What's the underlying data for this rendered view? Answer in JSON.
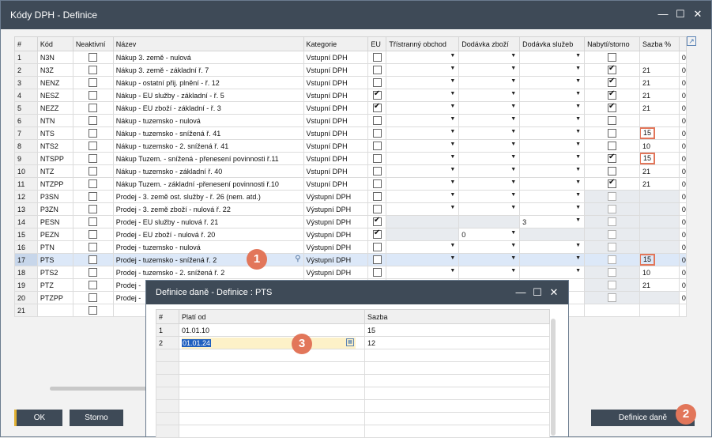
{
  "window": {
    "title": "Kódy DPH - Definice"
  },
  "grid": {
    "headers": [
      "#",
      "Kód",
      "Neaktivní",
      "Název",
      "Kategorie",
      "EU",
      "Třístranný obchod",
      "Dodávka zboží",
      "Dodávka služeb",
      "Nabytí/storno",
      "Sazba %"
    ],
    "rows": [
      {
        "n": "1",
        "kod": "N3N",
        "nazev": "Nákup 3. země - nulová",
        "kat": "Vstupní DPH",
        "eu": false,
        "nab": false,
        "sazba": "",
        "hl": false
      },
      {
        "n": "2",
        "kod": "N3Z",
        "nazev": "Nákup 3. země - základní ř. 7",
        "kat": "Vstupní DPH",
        "eu": false,
        "nab": true,
        "sazba": "21",
        "hl": false
      },
      {
        "n": "3",
        "kod": "NENZ",
        "nazev": "Nákup - ostatní přij. plnění - ř. 12",
        "kat": "Vstupní DPH",
        "eu": false,
        "nab": true,
        "sazba": "21",
        "hl": false
      },
      {
        "n": "4",
        "kod": "NESZ",
        "nazev": "Nákup - EU služby - základní - ř. 5",
        "kat": "Vstupní DPH",
        "eu": true,
        "nab": true,
        "sazba": "21",
        "hl": false
      },
      {
        "n": "5",
        "kod": "NEZZ",
        "nazev": "Nákup - EU zboží - základní - ř. 3",
        "kat": "Vstupní DPH",
        "eu": true,
        "nab": true,
        "sazba": "21",
        "hl": false
      },
      {
        "n": "6",
        "kod": "NTN",
        "nazev": "Nákup - tuzemsko - nulová",
        "kat": "Vstupní DPH",
        "eu": false,
        "nab": false,
        "sazba": "",
        "hl": false
      },
      {
        "n": "7",
        "kod": "NTS",
        "nazev": "Nákup - tuzemsko - snížená ř. 41",
        "kat": "Vstupní DPH",
        "eu": false,
        "nab": false,
        "sazba": "15",
        "hl": true
      },
      {
        "n": "8",
        "kod": "NTS2",
        "nazev": "Nákup - tuzemsko - 2. snížená ř. 41",
        "kat": "Vstupní DPH",
        "eu": false,
        "nab": false,
        "sazba": "10",
        "hl": false
      },
      {
        "n": "9",
        "kod": "NTSPP",
        "nazev": "Nákup Tuzem. - snížená - přenesení povinnosti ř.11",
        "kat": "Vstupní DPH",
        "eu": false,
        "nab": true,
        "sazba": "15",
        "hl": true
      },
      {
        "n": "10",
        "kod": "NTZ",
        "nazev": "Nákup - tuzemsko - základní ř. 40",
        "kat": "Vstupní DPH",
        "eu": false,
        "nab": false,
        "sazba": "21",
        "hl": false
      },
      {
        "n": "11",
        "kod": "NTZPP",
        "nazev": "Nákup Tuzem. - základní -přenesení povinnosti ř.10",
        "kat": "Vstupní DPH",
        "eu": false,
        "nab": true,
        "sazba": "21",
        "hl": false
      },
      {
        "n": "12",
        "kod": "P3SN",
        "nazev": "Prodej - 3. země ost. služby - ř. 26 (nem. atd.)",
        "kat": "Výstupní DPH",
        "eu": false,
        "nab": false,
        "sazba": "",
        "hl": false
      },
      {
        "n": "13",
        "kod": "P3ZN",
        "nazev": "Prodej - 3. země zboží - nulová ř. 22",
        "kat": "Výstupní DPH",
        "eu": false,
        "nab": false,
        "sazba": "",
        "hl": false
      },
      {
        "n": "14",
        "kod": "PESN",
        "nazev": "Prodej - EU služby - nulová ř. 21",
        "kat": "Výstupní DPH",
        "eu": true,
        "nab": false,
        "sazba": "",
        "hl": false
      },
      {
        "n": "15",
        "kod": "PEZN",
        "nazev": "Prodej - EU zboží - nulová ř. 20",
        "kat": "Výstupní DPH",
        "eu": true,
        "nab": false,
        "sazba": "",
        "hl": false
      },
      {
        "n": "16",
        "kod": "PTN",
        "nazev": "Prodej - tuzemsko - nulová",
        "kat": "Výstupní DPH",
        "eu": false,
        "nab": false,
        "sazba": "",
        "hl": false
      },
      {
        "n": "17",
        "kod": "PTS",
        "nazev": "Prodej - tuzemsko - snížená ř. 2",
        "kat": "Výstupní DPH",
        "eu": false,
        "nab": false,
        "sazba": "15",
        "hl": true
      },
      {
        "n": "18",
        "kod": "PTS2",
        "nazev": "Prodej - tuzemsko - 2. snížená ř. 2",
        "kat": "Výstupní DPH",
        "eu": false,
        "nab": false,
        "sazba": "10",
        "hl": false
      },
      {
        "n": "19",
        "kod": "PTZ",
        "nazev": "Prodej -",
        "kat": "",
        "eu": false,
        "nab": false,
        "sazba": "21",
        "hl": false
      },
      {
        "n": "20",
        "kod": "PTZPP",
        "nazev": "Prodej -",
        "kat": "",
        "eu": false,
        "nab": false,
        "sazba": "",
        "hl": false
      },
      {
        "n": "21",
        "kod": "",
        "nazev": "",
        "kat": "",
        "eu": false,
        "nab": false,
        "sazba": "",
        "hl": false
      }
    ],
    "dodavka_zbozi_15": "0",
    "dodavka_sluzeb_14": "3",
    "overflow_char": "0"
  },
  "buttons": {
    "ok": "OK",
    "storno": "Storno",
    "definice_dane": "Definice daně"
  },
  "badges": {
    "b1": "1",
    "b2": "2",
    "b3": "3"
  },
  "dialog": {
    "title": "Definice daně - Definice : PTS",
    "headers": [
      "#",
      "Platí od",
      "Sazba"
    ],
    "rows": [
      {
        "n": "1",
        "plati_od": "01.01.10",
        "sazba": "15"
      },
      {
        "n": "2",
        "plati_od": "01.01.24",
        "sazba": "12"
      }
    ]
  },
  "colors": {
    "titlebar": "#3e4a57",
    "accent": "#e2765a",
    "selected_row": "#dce8f8"
  }
}
